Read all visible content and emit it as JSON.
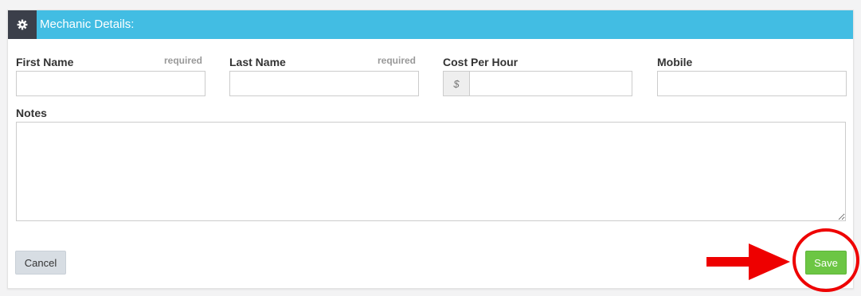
{
  "header": {
    "title": "Mechanic Details:",
    "icon": "gear-icon",
    "bar_color": "#42bde3",
    "icon_box_color": "#3b3f4a"
  },
  "form": {
    "first_name": {
      "label": "First Name",
      "required_text": "required",
      "value": ""
    },
    "last_name": {
      "label": "Last Name",
      "required_text": "required",
      "value": ""
    },
    "cost_per_hour": {
      "label": "Cost Per Hour",
      "prefix": "$",
      "value": ""
    },
    "mobile": {
      "label": "Mobile",
      "value": ""
    },
    "notes": {
      "label": "Notes",
      "value": ""
    }
  },
  "actions": {
    "cancel_label": "Cancel",
    "save_label": "Save",
    "save_color": "#6cc644"
  },
  "annotation": {
    "color": "#ee0000",
    "shapes": [
      "arrow",
      "circle"
    ]
  }
}
